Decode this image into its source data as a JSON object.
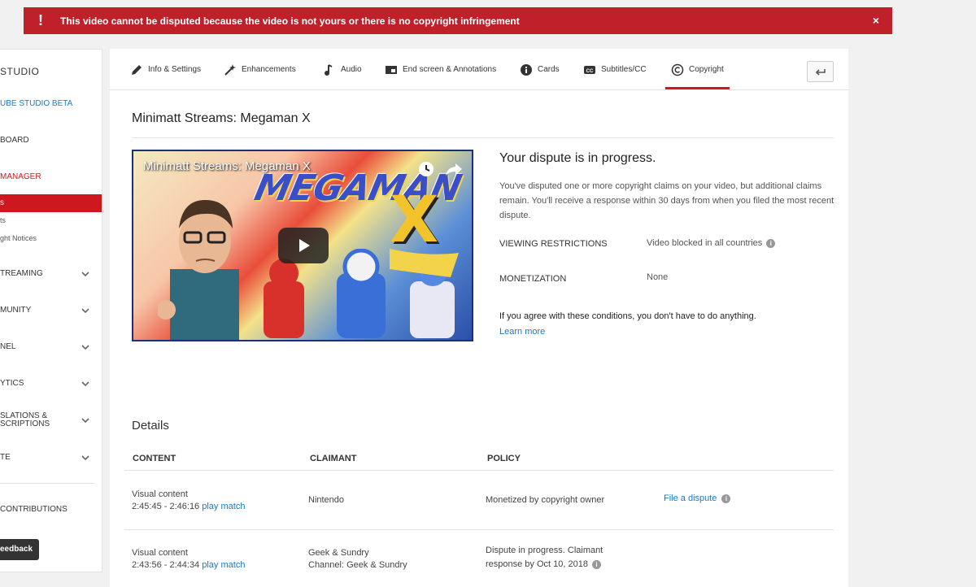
{
  "alert": {
    "icon": "exclamation-icon",
    "message": "This video cannot be disputed because the video is not yours or there is no copyright infringement",
    "close": "×"
  },
  "sidebar": {
    "studio": "STUDIO",
    "beta": "UBE STUDIO BETA",
    "dashboard": "BOARD",
    "manager": "MANAGER",
    "active_item": "s",
    "sub_item_1": "ts",
    "sub_item_2": "ght Notices",
    "sections": [
      "TREAMING",
      "MUNITY",
      "NEL",
      "YTICS",
      "SLATIONS &",
      "SCRIPTIONS",
      "TE"
    ],
    "contributions": "CONTRIBUTIONS",
    "feedback": "eedback"
  },
  "tabs": [
    {
      "label": "Info & Settings",
      "icon": "pencil-icon"
    },
    {
      "label": "Enhancements",
      "icon": "magic-wand-icon"
    },
    {
      "label": "Audio",
      "icon": "music-note-icon"
    },
    {
      "label": "End screen & Annotations",
      "icon": "end-screen-icon"
    },
    {
      "label": "Cards",
      "icon": "info-circle-icon"
    },
    {
      "label": "Subtitles/CC",
      "icon": "cc-icon"
    },
    {
      "label": "Copyright",
      "icon": "copyright-icon",
      "active": true
    }
  ],
  "video": {
    "title": "Minimatt Streams: Megaman X",
    "player_title": "Minimatt Streams: Megaman X",
    "logo": "MEGAMAN",
    "logo_x": "X"
  },
  "dispute": {
    "heading": "Your dispute is in progress.",
    "text": "You've disputed one or more copyright claims on your video, but additional claims remain. You'll receive a response within 30 days from when you filed the most recent dispute.",
    "viewing_label": "VIEWING RESTRICTIONS",
    "viewing_value": "Video blocked in all countries",
    "monetization_label": "MONETIZATION",
    "monetization_value": "None",
    "agree": "If you agree with these conditions, you don't have to do anything.",
    "learn_more": "Learn more"
  },
  "details": {
    "heading": "Details",
    "columns": [
      "CONTENT",
      "CLAIMANT",
      "POLICY"
    ],
    "rows": [
      {
        "content_type": "Visual content",
        "time_range": "2:45:45 - 2:46:16",
        "play_match": "play match",
        "claimant_line1": "Nintendo",
        "claimant_line2": "",
        "policy_line1": "Monetized by copyright owner",
        "policy_line2": "",
        "action": "File a dispute"
      },
      {
        "content_type": "Visual content",
        "time_range": "2:43:56 - 2:44:34",
        "play_match": "play match",
        "claimant_line1": "Geek & Sundry",
        "claimant_line2": "Channel: Geek & Sundry",
        "policy_line1": "Dispute in progress. Claimant",
        "policy_line2": "response by Oct 10, 2018",
        "action": ""
      }
    ]
  },
  "colors": {
    "alert_red": "#c0202a",
    "accent_red": "#cc181e",
    "link_blue": "#167ac6"
  }
}
